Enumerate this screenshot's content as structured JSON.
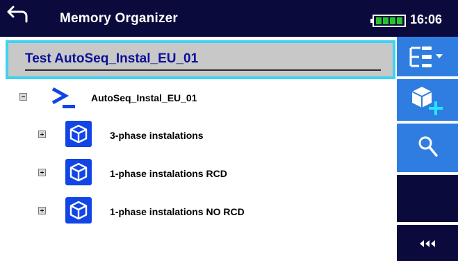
{
  "header": {
    "title": "Memory Organizer",
    "clock": "16:06",
    "icons": [
      "back-arrow-icon",
      "battery-icon"
    ],
    "background_color": "#0a0a3c"
  },
  "path_bar": {
    "selected_path": "Test AutoSeq_Instal_EU_01",
    "border_color": "#3fd3f0",
    "text_color": "#0b1196"
  },
  "tree": {
    "root": {
      "label": "AutoSeq_Instal_EU_01",
      "icon": "autosequence-icon",
      "expander": "collapse"
    },
    "children": [
      {
        "label": "3-phase instalations",
        "icon": "structure-cube-icon",
        "expander": "expand"
      },
      {
        "label": "1-phase instalations RCD",
        "icon": "structure-cube-icon",
        "expander": "expand"
      },
      {
        "label": "1-phase instalations NO RCD",
        "icon": "structure-cube-icon",
        "expander": "expand"
      }
    ]
  },
  "sidebar": {
    "buttons": [
      "tree-options-icon",
      "add-structure-icon",
      "search-icon",
      "more-icon"
    ],
    "accent_color": "#2f7de0"
  }
}
